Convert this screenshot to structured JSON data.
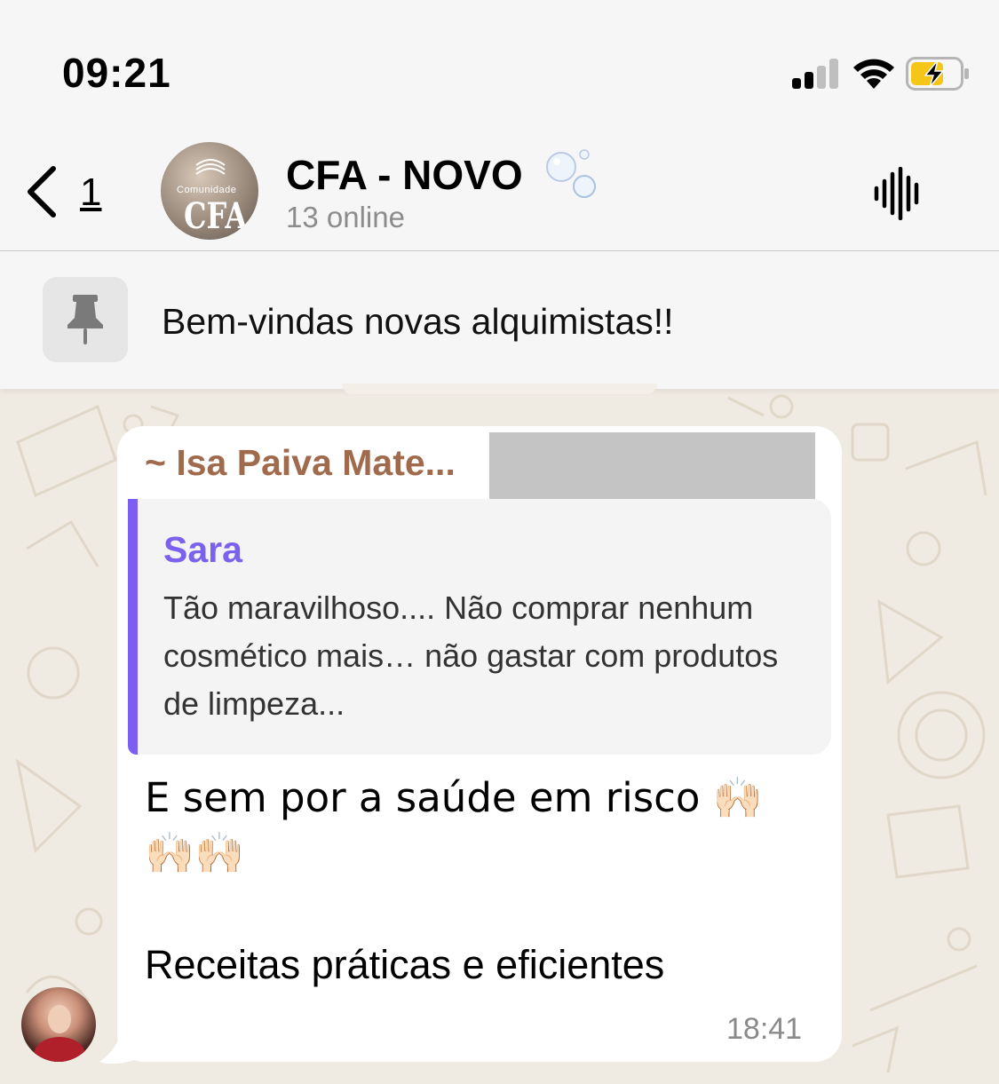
{
  "status_bar": {
    "time": "09:21",
    "icons": [
      "signal-icon",
      "wifi-icon",
      "battery-charging-icon"
    ]
  },
  "header": {
    "back_count": "1",
    "avatar_text_small": "Comunidade",
    "avatar_text_big": "CFA",
    "title": "CFA - NOVO",
    "title_icon": "bubbles-emoji",
    "subtitle": "13 online",
    "action_icon": "voice-chat-icon"
  },
  "pinned": {
    "icon": "pin-icon",
    "text": "Bem-vindas novas alquimistas!!"
  },
  "message": {
    "sender": "~ Isa Paiva Mate...",
    "quote": {
      "author": "Sara",
      "text": "Tão maravilhoso.... Não comprar nenhum cosmético mais… não gastar com produtos de limpeza..."
    },
    "line1": "E sem por a saúde em risco 🙌🏻",
    "line2": "🙌🏻🙌🏻",
    "line3": "Receitas práticas e eficientes",
    "time": "18:41"
  },
  "colors": {
    "sender": "#a06b4d",
    "quote_author": "#7b61ee",
    "quote_bar": "#7d5ef2",
    "wallpaper": "#efeae2"
  }
}
